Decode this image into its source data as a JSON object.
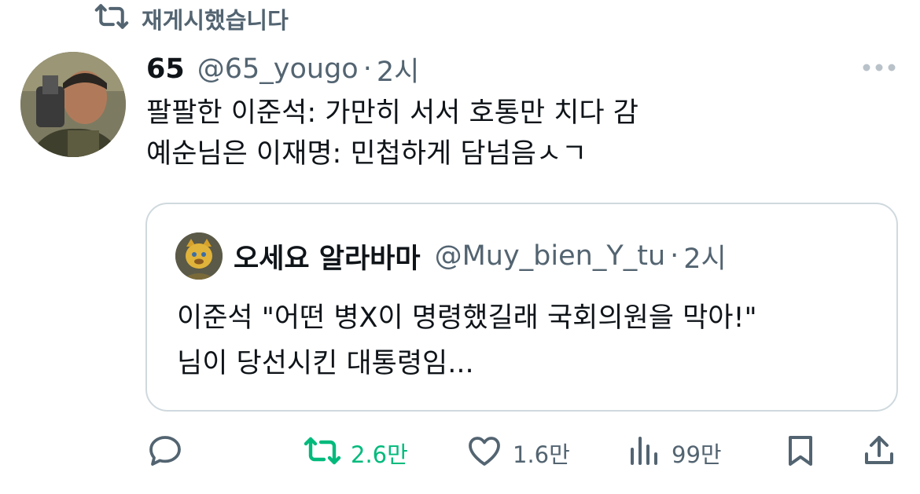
{
  "repost_banner": {
    "text": "재게시했습니다",
    "icon": "repost-icon"
  },
  "tweet": {
    "display_name": "65",
    "handle": "@65_yougo",
    "separator": "·",
    "time": "2시",
    "lines": [
      "팔팔한 이준석: 가만히 서서 호통만 치다 감",
      "예순님은 이재명: 민첩하게 담넘음ㅅㄱ"
    ]
  },
  "quote": {
    "display_name": "오세요 알라바마",
    "handle": "@Muy_bien_Y_tu",
    "separator": "·",
    "time": "2시",
    "lines": [
      "이준석 \"어떤 병X이 명령했길래 국회의원을 막아!\"",
      "님이 당선시킨 대통령임..."
    ]
  },
  "actions": {
    "reply": {
      "icon": "reply-icon"
    },
    "repost": {
      "icon": "repost-icon",
      "count": "2.6만",
      "color": "#00ba7c"
    },
    "like": {
      "icon": "heart-icon",
      "count": "1.6만"
    },
    "views": {
      "icon": "views-icon",
      "count": "99만"
    },
    "bookmark": {
      "icon": "bookmark-icon"
    },
    "share": {
      "icon": "share-icon"
    }
  },
  "colors": {
    "text": "#0f1419",
    "secondary": "#536471",
    "border": "#cfd9de",
    "repost_active": "#00ba7c"
  }
}
